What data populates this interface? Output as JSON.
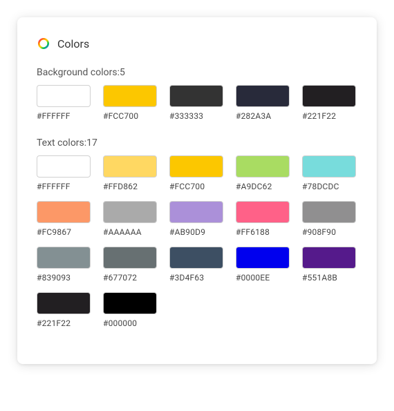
{
  "header": {
    "title": "Colors",
    "icon": "color-ring-icon"
  },
  "sections": {
    "background": {
      "label_prefix": "Background colors:",
      "count": 5,
      "colors": [
        {
          "hex": "#FFFFFF"
        },
        {
          "hex": "#FCC700"
        },
        {
          "hex": "#333333"
        },
        {
          "hex": "#282A3A"
        },
        {
          "hex": "#221F22"
        }
      ]
    },
    "text": {
      "label_prefix": "Text colors:",
      "count": 17,
      "colors": [
        {
          "hex": "#FFFFFF"
        },
        {
          "hex": "#FFD862"
        },
        {
          "hex": "#FCC700"
        },
        {
          "hex": "#A9DC62"
        },
        {
          "hex": "#78DCDC"
        },
        {
          "hex": "#FC9867"
        },
        {
          "hex": "#AAAAAA"
        },
        {
          "hex": "#AB90D9"
        },
        {
          "hex": "#FF6188"
        },
        {
          "hex": "#908F90"
        },
        {
          "hex": "#839093"
        },
        {
          "hex": "#677072"
        },
        {
          "hex": "#3D4F63"
        },
        {
          "hex": "#0000EE"
        },
        {
          "hex": "#551A8B"
        },
        {
          "hex": "#221F22"
        },
        {
          "hex": "#000000"
        }
      ]
    }
  }
}
